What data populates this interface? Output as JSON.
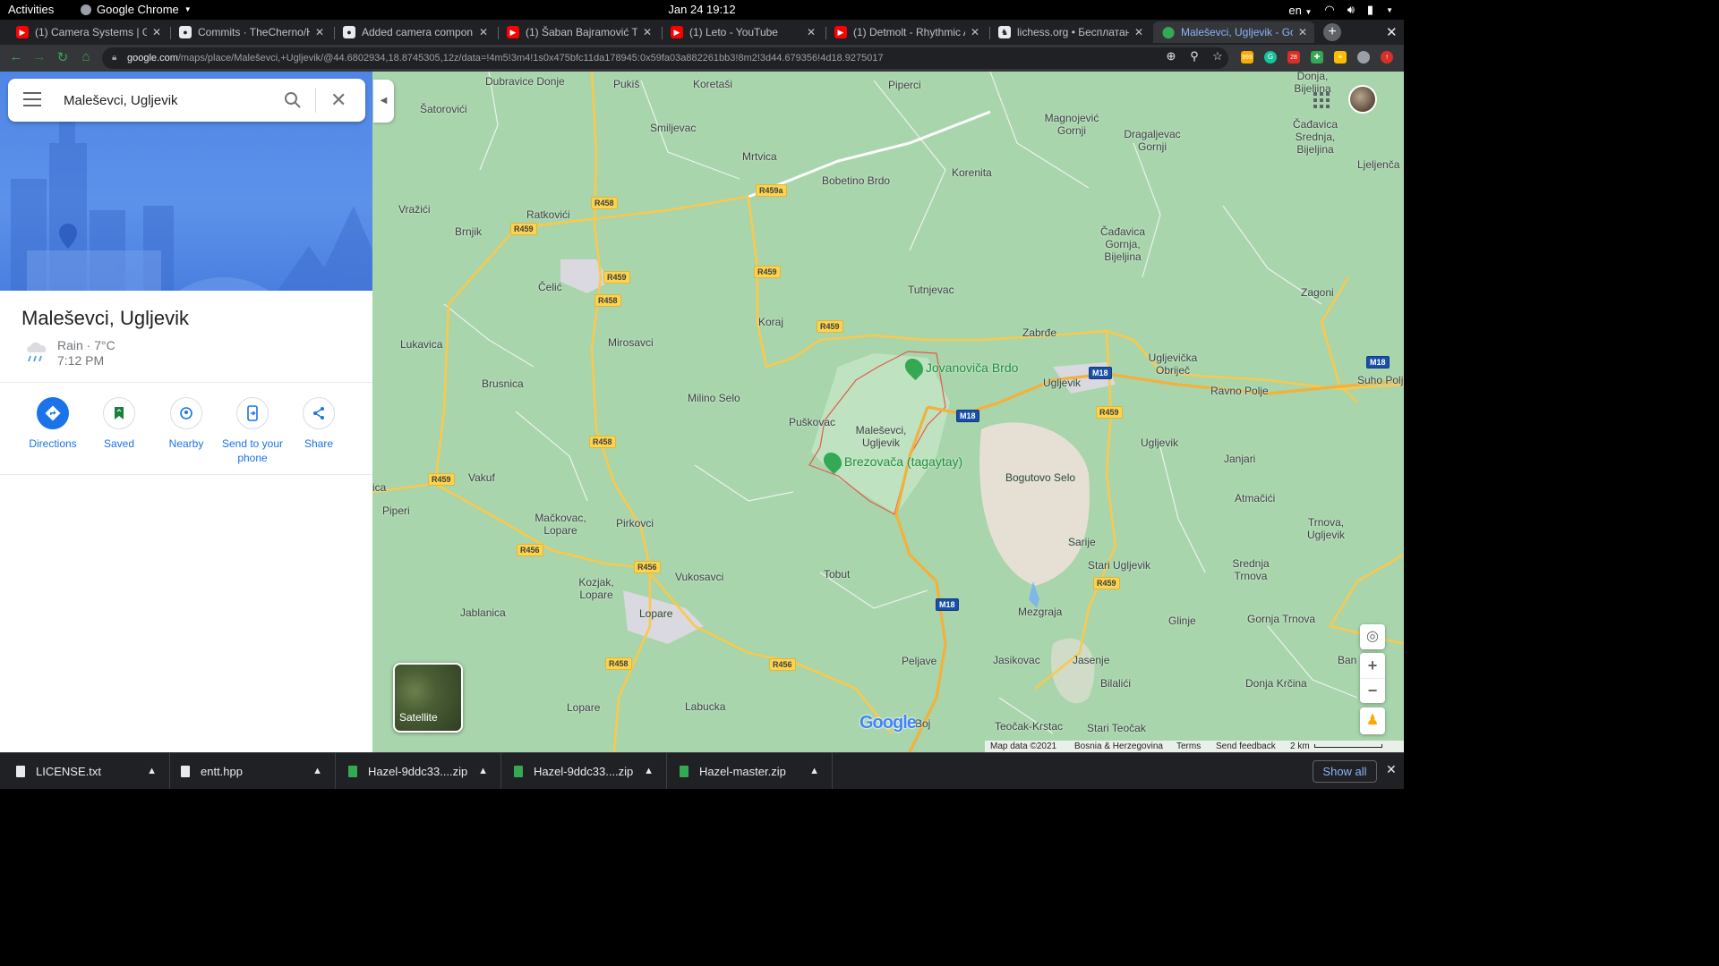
{
  "system": {
    "activities": "Activities",
    "app_name": "Google Chrome",
    "clock": "Jan 24  19:12",
    "lang": "en"
  },
  "tabs": [
    {
      "title": "(1) Camera Systems | Ga",
      "favicon": "youtube-icon"
    },
    {
      "title": "Commits · TheCherno/H",
      "favicon": "github-icon"
    },
    {
      "title": "Added camera compon",
      "favicon": "github-icon"
    },
    {
      "title": "(1) Šaban Bajramović Tu",
      "favicon": "youtube-icon"
    },
    {
      "title": "(1) Leto - YouTube",
      "favicon": "youtube-icon"
    },
    {
      "title": "(1) Detmolt - Rhythmic A",
      "favicon": "youtube-icon"
    },
    {
      "title": "lichess.org • Бесплатан",
      "favicon": "lichess-icon"
    },
    {
      "title": "Maleševci, Ugljevik - Go",
      "favicon": "maps-icon"
    }
  ],
  "toolbar": {
    "url_host": "google.com",
    "url_path": "/maps/place/Maleševci,+Ugljevik/@44.6802934,18.8745305,12z/data=!4m5!3m4!1s0x475bfc11da178945:0x59fa03a882261bb3!8m2!3d44.679356!4d18.9275017",
    "ext_badge_1": "999",
    "ext_badge_2": "28"
  },
  "search": {
    "value": "Maleševci, Ugljevik"
  },
  "place": {
    "title": "Maleševci, Ugljevik",
    "weather": "Rain · 7°C",
    "time": "7:12 PM"
  },
  "actions": [
    {
      "label": "Directions",
      "icon": "directions-icon"
    },
    {
      "label": "Saved",
      "icon": "bookmark-icon"
    },
    {
      "label": "Nearby",
      "icon": "nearby-icon"
    },
    {
      "label": "Send to your phone",
      "icon": "send-to-phone-icon"
    },
    {
      "label": "Share",
      "icon": "share-icon"
    }
  ],
  "map": {
    "places": [
      "Dubravice Donje",
      "Pukiš",
      "Koretaši",
      "Piperci",
      "Šatorovići",
      "Smiljevac",
      "Magnojević Gornji",
      "Dragaljevac Gornji",
      "Čađavica Srednja, Bijeljina",
      "Mrtvica",
      "Bobetino Brdo",
      "Korenita",
      "Vražići",
      "Ratkovići",
      "Brnjik",
      "Ljeljenča",
      "Čađavica Gornja, Bijeljina",
      "Čelić",
      "Tutnjevac",
      "Zagoni",
      "Koraj",
      "Lukavica",
      "Mirosavci",
      "Zabrđe",
      "Ugljevička Obriječ",
      "Brusnica",
      "Ugljevik",
      "Ravno Polje",
      "Suho Polje",
      "Milino Selo",
      "Puškovac",
      "Maleševci, Ugljevik",
      "Ugljevik",
      "Janjari",
      "Bogutovo Selo",
      "Vakuf",
      "Atmačići",
      "Piperi",
      "Mačkovac, Lopare",
      "Pirkovci",
      "Sarije",
      "Trnova, Ugljevik",
      "Stari Ugljevik",
      "Srednja Trnova",
      "Tobut",
      "Vukosavci",
      "Kozjak, Lopare",
      "Jablanica",
      "Lopare",
      "Mezgraja",
      "Glinje",
      "Gornja Trnova",
      "Peljave",
      "Jasikovac",
      "Jasenje",
      "Bilalići",
      "Donja Krčina",
      "Lopare",
      "Labucka",
      "Teočak-Krstac",
      "Stari Teočak",
      "Donja, Bijeljina",
      "Ban",
      "Boj",
      "ica"
    ],
    "road_labels": [
      "R458",
      "R459a",
      "R459",
      "R459",
      "R459",
      "R458",
      "R459",
      "R458",
      "R459",
      "R459",
      "R456",
      "R456",
      "R458",
      "R456",
      "R459",
      "M18",
      "M18",
      "M18",
      "R459",
      "M18"
    ],
    "pois": [
      "Jovanoviča Brdo",
      "Brezovača (tagaytay)"
    ],
    "satellite_label": "Satellite",
    "logo": "Google",
    "attribution": {
      "data": "Map data ©2021",
      "country": "Bosnia & Herzegovina",
      "terms": "Terms",
      "feedback": "Send feedback",
      "scale": "2 km"
    }
  },
  "downloads": [
    {
      "name": "LICENSE.txt",
      "type": "file"
    },
    {
      "name": "entt.hpp",
      "type": "file"
    },
    {
      "name": "Hazel-9ddc33....zip",
      "type": "zip"
    },
    {
      "name": "Hazel-9ddc33....zip",
      "type": "zip"
    },
    {
      "name": "Hazel-master.zip",
      "type": "zip"
    }
  ],
  "downloads_show_all": "Show all"
}
